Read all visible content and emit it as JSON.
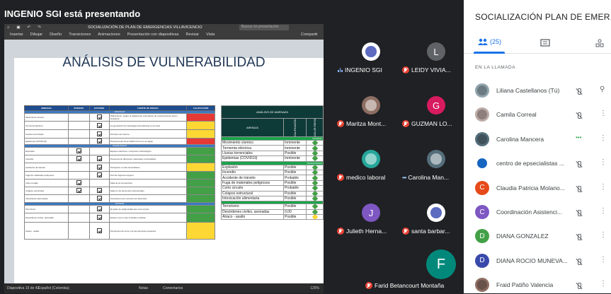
{
  "stage": {
    "presenter_label": "INGENIO SGI está presentando"
  },
  "ppt": {
    "doc_title": "SOCIALIZACIÓN DE PLAN DE EMERGENCIAS VILLAVICENCIO",
    "search_placeholder": "Buscar en presentación",
    "menu": [
      "Insertar",
      "Dibujar",
      "Diseño",
      "Transiciones",
      "Animaciones",
      "Presentación con diapositivas",
      "Revisar",
      "Vista"
    ],
    "share_label": "Compartir",
    "slide_title": "ANÁLISIS DE VULNERABILIDAD",
    "left_table": {
      "headers": [
        "AMENAZA",
        "INTERNO",
        "EXTERNO",
        "FUENTE DE RIESGO",
        "CALIFICACIÓN"
      ],
      "sections": [
        "NATURALES",
        "TECNOLÓGICOS",
        "SOCIALES"
      ],
      "rows": [
        {
          "amenaza": "Movimiento sísmico",
          "fuente": "Villavicencio, según el reglamento colombiano de construcciones sismo resistente",
          "color": "#e53935"
        },
        {
          "amenaza": "Tormenta eléctrica",
          "fuente": "La generación de descargas atmosféricas en la zona",
          "color": "#fdd835"
        },
        {
          "amenaza": "Lluvias torrenciales",
          "fuente": "Periodos de invierno",
          "color": "#fdd835"
        },
        {
          "amenaza": "Epidemias (COVID19)",
          "fuente": "Presencia del Virus SARS-CoV-2 en la región",
          "color": "#e53935"
        },
        {
          "amenaza": "Explosión",
          "fuente": "Equipos eléctricos, compresor odontológico",
          "color": "#43a047"
        },
        {
          "amenaza": "Incendio",
          "fuente": "Presencia de diferentes materiales combustibles",
          "color": "#43a047"
        },
        {
          "amenaza": "Accidente de tránsito",
          "fuente": "Transporte a rutas domiciliarias",
          "color": "#fdd835"
        },
        {
          "amenaza": "Fuga de materiales peligrosos",
          "fuente": "Permitir fuga del oxígeno",
          "color": "#43a047"
        },
        {
          "amenaza": "Cielo cerrado",
          "fuente": "Falla de la red eléctrica",
          "color": "#43a047"
        },
        {
          "amenaza": "Colapso estructural",
          "fuente": "Falla en los elementos estructurales",
          "color": "#43a047"
        },
        {
          "amenaza": "Intoxicación alimentaria",
          "fuente": "Intoxicación por consumo de alimentos",
          "color": "#43a047"
        },
        {
          "amenaza": "Terrorismo",
          "fuente": "El grado de peligrosidad que crea el país",
          "color": "#43a047"
        },
        {
          "amenaza": "Desórdenes civiles, asonadas",
          "fuente": "Existen como a las centrales médicas",
          "color": "#43a047"
        },
        {
          "amenaza": "Atraco - asalto",
          "fuente": "Percepción de temor por las personas presentes",
          "color": "#fdd835"
        }
      ]
    },
    "right_table": {
      "title": "ANÁLISIS DE AMENAZA",
      "col_amenaza": "AMENAZA",
      "col_calificacion": "CALIFICACIÓN",
      "col_color": "COLOR RIESGO",
      "sections": [
        "NATURAL",
        "TECNOLÓGICA"
      ],
      "rows": [
        {
          "amenaza": "Movimiento sísmico",
          "cal": "Inminente",
          "color": "#43a047"
        },
        {
          "amenaza": "Tormenta eléctrica",
          "cal": "Inminente",
          "color": "#43a047"
        },
        {
          "amenaza": "Lluvias torrenciales",
          "cal": "Posible",
          "color": "#43a047"
        },
        {
          "amenaza": "Epidemias (COVID19)",
          "cal": "Inminente",
          "color": "#43a047"
        },
        {
          "amenaza": "Explosión",
          "cal": "Posible",
          "color": "#43a047"
        },
        {
          "amenaza": "Incendio",
          "cal": "Posible",
          "color": "#43a047"
        },
        {
          "amenaza": "Accidente de tránsito",
          "cal": "Probable",
          "color": "#43a047"
        },
        {
          "amenaza": "Fuga de materiales peligrosos",
          "cal": "Posible",
          "color": "#43a047"
        },
        {
          "amenaza": "Corto circuito",
          "cal": "Probable",
          "color": "#43a047"
        },
        {
          "amenaza": "Colapso estructural",
          "cal": "Posible",
          "color": "#43a047"
        },
        {
          "amenaza": "Intoxicación alimentaria",
          "cal": "Posible",
          "color": "#43a047"
        },
        {
          "amenaza": "Terrorismo",
          "cal": "Posible",
          "color": "#43a047"
        },
        {
          "amenaza": "Desórdenes civiles, asonadas",
          "cal": "0,00",
          "color": "#43a047"
        },
        {
          "amenaza": "Atraco - asalto",
          "cal": "Posible",
          "color": "#fdd835"
        }
      ]
    },
    "status": {
      "slide": "Diapositiva 15 de 42",
      "lang": "Español (Colombia)",
      "notes": "Notas",
      "comments": "Comentarios",
      "zoom": "125%"
    }
  },
  "tiles": [
    {
      "name": "INGENIO SGI",
      "initial": "",
      "color": "#ffffff",
      "state": "speaking"
    },
    {
      "name": "LEIDY VIVIA...",
      "initial": "L",
      "color": "#5f6368",
      "state": "muted"
    },
    {
      "name": "Maritza Mont...",
      "initial": "",
      "color": "#8d6e63",
      "state": "muted"
    },
    {
      "name": "GUZMAN LO...",
      "initial": "G",
      "color": "#d81b60",
      "state": "muted"
    },
    {
      "name": "medico laboral",
      "initial": "",
      "color": "#26a69a",
      "state": "muted"
    },
    {
      "name": "Carolina Man...",
      "initial": "",
      "color": "#546e7a",
      "state": "dots"
    },
    {
      "name": "Julieth Herna...",
      "initial": "J",
      "color": "#7e57c2",
      "state": "muted"
    },
    {
      "name": "santa barbar...",
      "initial": "",
      "color": "#ffffff",
      "state": "muted"
    },
    {
      "name": "Farid Betancourt Montaña",
      "initial": "F",
      "color": "#00897b",
      "state": "muted"
    }
  ],
  "panel": {
    "title": "SOCIALIZACIÓN PLAN DE EMER...",
    "people_count": "(25)",
    "in_call_label": "EN LA LLAMADA",
    "people": [
      {
        "name": "Liliana Castellanos (Tú)",
        "initial": "",
        "color": "#90a4ae",
        "state": "muted"
      },
      {
        "name": "Camila Correal",
        "initial": "",
        "color": "#bcaaa4",
        "state": "muted"
      },
      {
        "name": "Carolina Mancera",
        "initial": "",
        "color": "#546e7a",
        "state": "dots"
      },
      {
        "name": "centro de epsecialistas ...",
        "initial": "",
        "color": "#ffffff",
        "state": "muted"
      },
      {
        "name": "Claudia Patricia Molano...",
        "initial": "C",
        "color": "#e64a19",
        "state": "muted"
      },
      {
        "name": "Coordinación Asistenci...",
        "initial": "C",
        "color": "#7e57c2",
        "state": "muted"
      },
      {
        "name": "DIANA GONZALEZ",
        "initial": "D",
        "color": "#43a047",
        "state": "muted"
      },
      {
        "name": "DIANA ROCIO MUNEVA...",
        "initial": "D",
        "color": "#3949ab",
        "state": "muted"
      },
      {
        "name": "Fraid Patiño Valencia",
        "initial": "",
        "color": "#8d6e63",
        "state": "muted"
      }
    ]
  }
}
